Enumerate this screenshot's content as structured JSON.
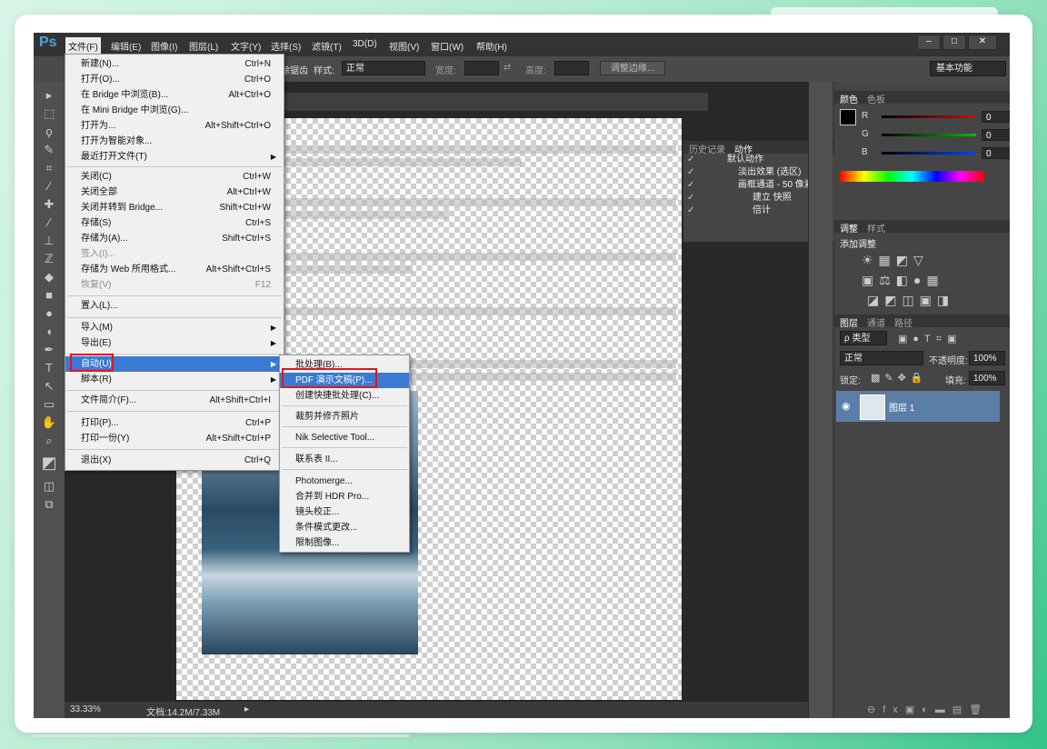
{
  "menubar": {
    "logo": "Ps",
    "items": [
      "文件(F)",
      "编辑(E)",
      "图像(I)",
      "图层(L)",
      "文字(Y)",
      "选择(S)",
      "滤镜(T)",
      "3D(D)",
      "视图(V)",
      "窗口(W)",
      "帮助(H)"
    ],
    "active_index": 0
  },
  "window_buttons": {
    "minimize": "–",
    "maximize": "□",
    "close": "✕"
  },
  "options": {
    "partial_label": "消除锯齿",
    "style_label": "样式:",
    "style_value": "正常",
    "width_label": "宽度:",
    "height_label": "高度:",
    "refine_edge": "调整边缘...",
    "workspace": "基本功能"
  },
  "file_menu": {
    "items": [
      {
        "label": "新建(N)...",
        "shortcut": "Ctrl+N"
      },
      {
        "label": "打开(O)...",
        "shortcut": "Ctrl+O"
      },
      {
        "label": "在 Bridge 中浏览(B)...",
        "shortcut": "Alt+Ctrl+O"
      },
      {
        "label": "在 Mini Bridge 中浏览(G)...",
        "shortcut": ""
      },
      {
        "label": "打开为...",
        "shortcut": "Alt+Shift+Ctrl+O"
      },
      {
        "label": "打开为智能对象...",
        "shortcut": ""
      },
      {
        "label": "最近打开文件(T)",
        "shortcut": ""
      },
      {
        "label": "关闭(C)",
        "shortcut": "Ctrl+W"
      },
      {
        "label": "关闭全部",
        "shortcut": "Alt+Ctrl+W"
      },
      {
        "label": "关闭并转到 Bridge...",
        "shortcut": "Shift+Ctrl+W"
      },
      {
        "label": "存储(S)",
        "shortcut": "Ctrl+S"
      },
      {
        "label": "存储为(A)...",
        "shortcut": "Shift+Ctrl+S"
      },
      {
        "label": "签入(I)...",
        "shortcut": ""
      },
      {
        "label": "存储为 Web 所用格式...",
        "shortcut": "Alt+Shift+Ctrl+S"
      },
      {
        "label": "恢复(V)",
        "shortcut": "F12"
      },
      {
        "label": "置入(L)...",
        "shortcut": ""
      },
      {
        "label": "导入(M)",
        "shortcut": ""
      },
      {
        "label": "导出(E)",
        "shortcut": ""
      },
      {
        "label": "自动(U)",
        "shortcut": ""
      },
      {
        "label": "脚本(R)",
        "shortcut": ""
      },
      {
        "label": "文件简介(F)...",
        "shortcut": "Alt+Shift+Ctrl+I"
      },
      {
        "label": "打印(P)...",
        "shortcut": "Ctrl+P"
      },
      {
        "label": "打印一份(Y)",
        "shortcut": "Alt+Shift+Ctrl+P"
      },
      {
        "label": "退出(X)",
        "shortcut": "Ctrl+Q"
      }
    ],
    "highlighted": "自动(U)"
  },
  "automate_menu": {
    "items": [
      "批处理(B)...",
      "PDF 演示文稿(P)...",
      "创建快捷批处理(C)...",
      "裁剪并修齐照片",
      "Nik Selective Tool...",
      "联系表 II...",
      "Photomerge...",
      "合并到 HDR Pro...",
      "镜头校正...",
      "条件模式更改...",
      "限制图像..."
    ],
    "highlighted": "PDF 演示文稿(P)..."
  },
  "history_panel": {
    "tabs": [
      "历史记录",
      "动作"
    ],
    "active_tab": "动作",
    "rows": [
      "默认动作",
      "淡出效果 (选区)",
      "画框通道 - 50 像素",
      "建立 快照",
      "倍计"
    ]
  },
  "color_panel": {
    "tabs": [
      "颜色",
      "色板"
    ],
    "channels": [
      {
        "label": "R",
        "value": "0",
        "color": "#e00000"
      },
      {
        "label": "G",
        "value": "0",
        "color": "#00c000"
      },
      {
        "label": "B",
        "value": "0",
        "color": "#0044ff"
      }
    ]
  },
  "adjust_panel": {
    "tabs": [
      "调整",
      "样式"
    ],
    "title": "添加调整"
  },
  "layers_panel": {
    "tabs": [
      "图层",
      "通道",
      "路径"
    ],
    "filter": "ρ 类型",
    "blend_mode": "正常",
    "opacity_label": "不透明度:",
    "opacity": "100%",
    "lock_label": "锁定:",
    "fill_label": "填充:",
    "fill": "100%",
    "layer_name": "图层 1"
  },
  "status": {
    "zoom": "33.33%",
    "doc": "文档:14.2M/7.33M"
  },
  "colors": {
    "highlight": "#3a7ad3",
    "annotation": "#e3141d"
  }
}
